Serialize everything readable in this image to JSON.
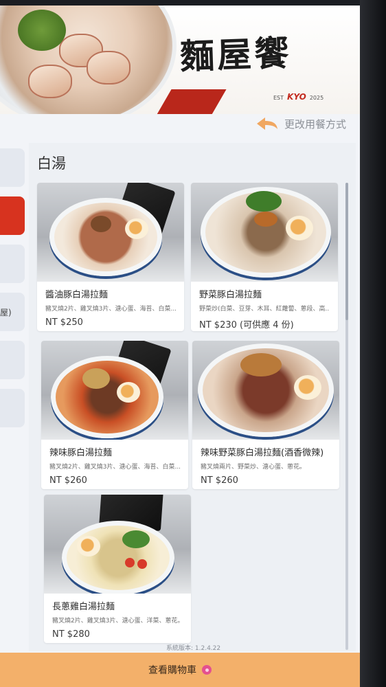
{
  "brand": {
    "logo_text": "麵屋饗",
    "est_label": "EST",
    "name_latin": "KYO",
    "year": "2025"
  },
  "header": {
    "change_dining_label": "更改用餐方式"
  },
  "sidebar": {
    "active_index": 1,
    "fragment_text": "屋)"
  },
  "section": {
    "title": "白湯"
  },
  "menu_items": [
    {
      "name": "醬油豚白湯拉麵",
      "desc": "豬叉燒2片、雞叉燒3片、溏心蛋、海苔、白菜...",
      "price": "NT $250"
    },
    {
      "name": "野菜豚白湯拉麵",
      "desc": "野菜炒(白菜、豆芽、木耳、紅蘿蔔、蔥段、高...",
      "price": "NT $230 (可供應 4 份)"
    },
    {
      "name": "辣味豚白湯拉麵",
      "desc": "豬叉燒2片、雞叉燒3片、溏心蛋、海苔、白菜...",
      "price": "NT $260"
    },
    {
      "name": "辣味野菜豚白湯拉麵(酒香微辣)",
      "desc": "豬叉燒兩片、野菜炒、溏心蛋、蔥花。",
      "price": "NT $260"
    },
    {
      "name": "長蔥雞白湯拉麵",
      "desc": "豬叉燒2片、雞叉燒3片、溏心蛋、洋菜、蔥花。",
      "price": "NT $280"
    }
  ],
  "footer": {
    "version_text": "系統版本: 1.2.4.22",
    "cart_label": "查看購物車"
  },
  "icons": {
    "back": "back-arrow-icon",
    "cart_badge": "cart-badge-icon"
  },
  "colors": {
    "accent_red": "#d7331f",
    "cart_bar": "#f3b06a",
    "badge_pink": "#e4508f"
  }
}
